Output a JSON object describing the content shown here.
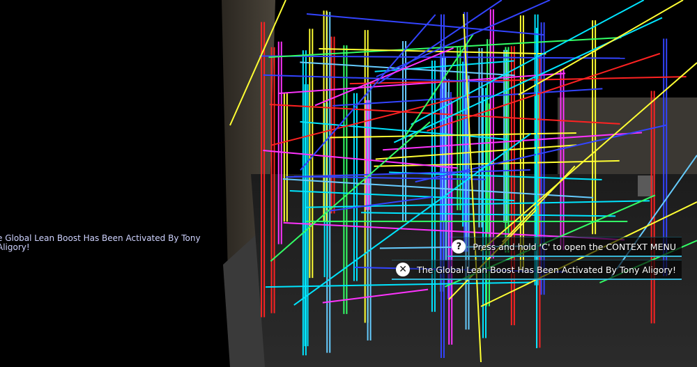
{
  "chat": {
    "message": "e Global Lean Boost Has Been Activated By Tony Aligory!"
  },
  "notifications": [
    {
      "icon": "question-icon",
      "glyph": "?",
      "text": "Press and hold 'C' to open the CONTEXT MENU"
    },
    {
      "icon": "close-icon",
      "glyph": "✕",
      "text": "The Global Lean Boost Has Been Activated By Tony Aligory!"
    }
  ],
  "colors": {
    "accent": "#37b6d6",
    "wire_palette": [
      "#ffff33",
      "#00e5ff",
      "#ff33ff",
      "#3344ff",
      "#ff2222",
      "#33ff66",
      "#66ccff"
    ]
  }
}
